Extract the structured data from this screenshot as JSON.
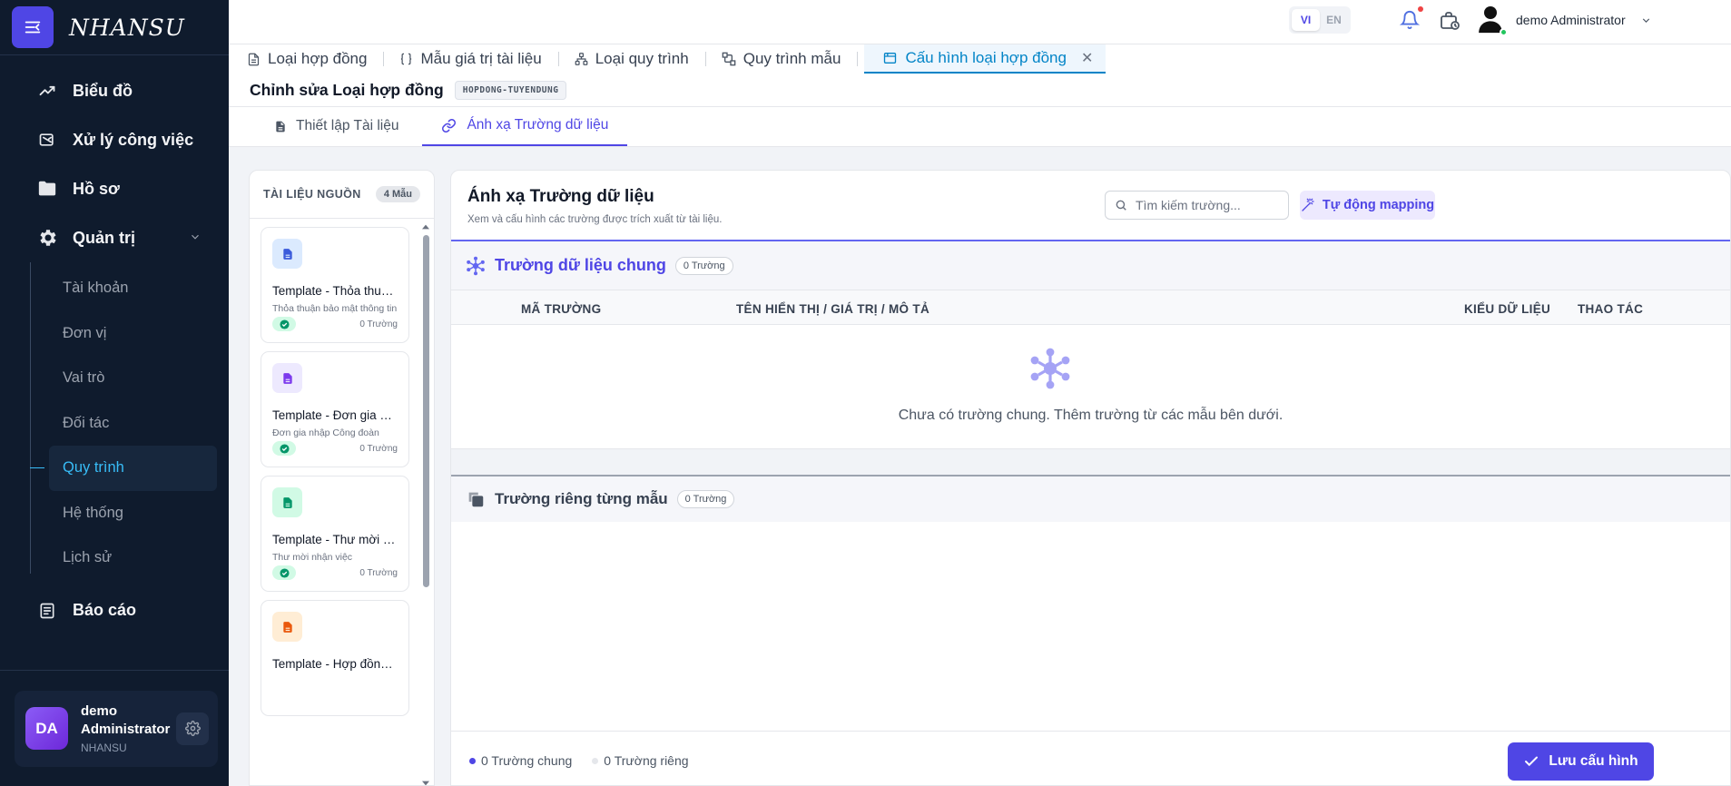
{
  "app": {
    "brand": "NHANSU"
  },
  "sidebar": {
    "items": [
      {
        "label": "Biểu đồ",
        "icon": "chart-line-icon"
      },
      {
        "label": "Xử lý công việc",
        "icon": "task-icon"
      },
      {
        "label": "Hồ sơ",
        "icon": "folder-icon"
      },
      {
        "label": "Quản trị",
        "icon": "gear-icon"
      }
    ],
    "sub_items": [
      "Tài khoản",
      "Đơn vị",
      "Vai trò",
      "Đối tác",
      "Quy trình",
      "Hệ thống",
      "Lịch sử"
    ],
    "active_sub": "Quy trình",
    "report": {
      "label": "Báo cáo",
      "icon": "report-icon"
    },
    "user": {
      "initials": "DA",
      "name": "demo Administrator",
      "org": "NHANSU"
    }
  },
  "topbar": {
    "lang": [
      "VI",
      "EN"
    ],
    "lang_active": "VI",
    "user_name": "demo Administrator"
  },
  "tabs": [
    {
      "label": "Loại hợp đồng",
      "icon": "document-icon"
    },
    {
      "label": "Mẫu giá trị tài liệu",
      "icon": "braces-icon"
    },
    {
      "label": "Loại quy trình",
      "icon": "flow-icon"
    },
    {
      "label": "Quy trình mẫu",
      "icon": "diagram-icon"
    },
    {
      "label": "Cấu hình loại hợp đồng",
      "icon": "window-icon",
      "active": true
    }
  ],
  "page": {
    "title": "Chỉnh sửa Loại hợp đồng",
    "code": "HOPDONG-TUYENDUNG"
  },
  "subtabs": [
    {
      "label": "Thiết lập Tài liệu",
      "icon": "document-icon"
    },
    {
      "label": "Ánh xạ Trường dữ liệu",
      "icon": "link-icon",
      "active": true
    }
  ],
  "source_panel": {
    "title": "TÀI LIỆU NGUỒN",
    "count": "4 Mẫu",
    "templates": [
      {
        "name": "Template - Thỏa thuận ...",
        "desc": "Thỏa thuận bảo mật thông tin",
        "count": "0 Trường",
        "color": "#dbeafe",
        "icon_color": "#3b5bdb"
      },
      {
        "name": "Template - Đơn gia nhậ...",
        "desc": "Đơn gia nhập Công đoàn",
        "count": "0 Trường",
        "color": "#ede9fe",
        "icon_color": "#7c3aed"
      },
      {
        "name": "Template - Thư mời nh...",
        "desc": "Thư mời nhận việc",
        "count": "0 Trường",
        "color": "#d1fae5",
        "icon_color": "#059669"
      },
      {
        "name": "Template - Hợp đồng ...",
        "desc": "",
        "count": "",
        "color": "#ffedd5",
        "icon_color": "#ea580c"
      }
    ]
  },
  "mapping": {
    "title": "Ánh xạ Trường dữ liệu",
    "desc": "Xem và cấu hình các trường được trích xuất từ tài liệu.",
    "search_placeholder": "Tìm kiếm trường...",
    "auto_label": "Tự động mapping",
    "common": {
      "title": "Trường dữ liệu chung",
      "count": "0 Trường"
    },
    "columns": [
      "MÃ TRƯỜNG",
      "TÊN HIỂN THỊ / GIÁ TRỊ / MÔ TẢ",
      "KIỂU DỮ LIỆU",
      "THAO TÁC"
    ],
    "empty_text": "Chưa có trường chung. Thêm trường từ các mẫu bên dưới.",
    "private": {
      "title": "Trường riêng từng mẫu",
      "count": "0 Trường"
    },
    "legend_common": "0 Trường chung",
    "legend_private": "0 Trường riêng",
    "save_label": "Lưu cấu hình"
  },
  "colors": {
    "accent": "#4f46e5",
    "sidebar_bg": "#0f1b2d",
    "active_tab": "#0284c7"
  }
}
